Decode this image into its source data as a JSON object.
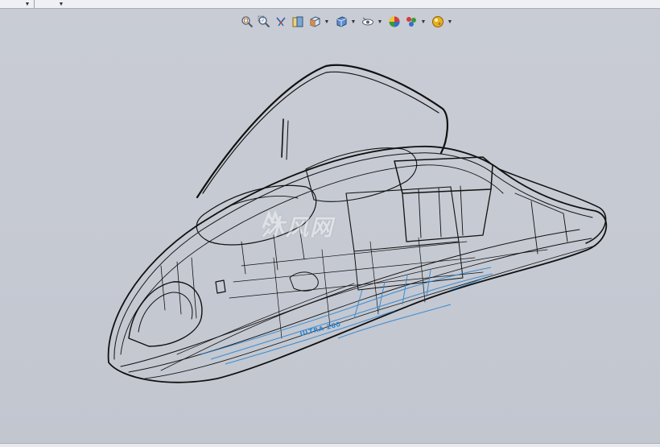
{
  "top_bar": {
    "dropdowns": [
      "chevron-down-icon",
      "chevron-down-icon"
    ]
  },
  "heads_up_toolbar": {
    "buttons": [
      {
        "name": "zoom-to-fit",
        "icon": "zoom-fit-icon",
        "dropdown": false
      },
      {
        "name": "zoom-to-area",
        "icon": "zoom-area-icon",
        "dropdown": false
      },
      {
        "name": "previous-view",
        "icon": "previous-view-icon",
        "dropdown": false
      },
      {
        "name": "section-view",
        "icon": "section-view-icon",
        "dropdown": false
      },
      {
        "name": "view-orientation",
        "icon": "view-orientation-icon",
        "dropdown": true
      },
      {
        "name": "display-style",
        "icon": "display-style-icon",
        "dropdown": true
      },
      {
        "name": "hide-show-items",
        "icon": "hide-show-icon",
        "dropdown": true
      },
      {
        "name": "edit-appearance",
        "icon": "edit-appearance-icon",
        "dropdown": false
      },
      {
        "name": "apply-scene",
        "icon": "apply-scene-icon",
        "dropdown": true
      },
      {
        "name": "view-settings",
        "icon": "view-settings-icon",
        "dropdown": true
      }
    ]
  },
  "viewport": {
    "model": "jet-ski wireframe",
    "display_mode": "wireframe",
    "watermark_text": "沐风网",
    "hull_label": "ULTRA 260"
  },
  "colors": {
    "background": "#c6cad3",
    "wire": "#111111",
    "accent_wire": "#2f86d0"
  }
}
